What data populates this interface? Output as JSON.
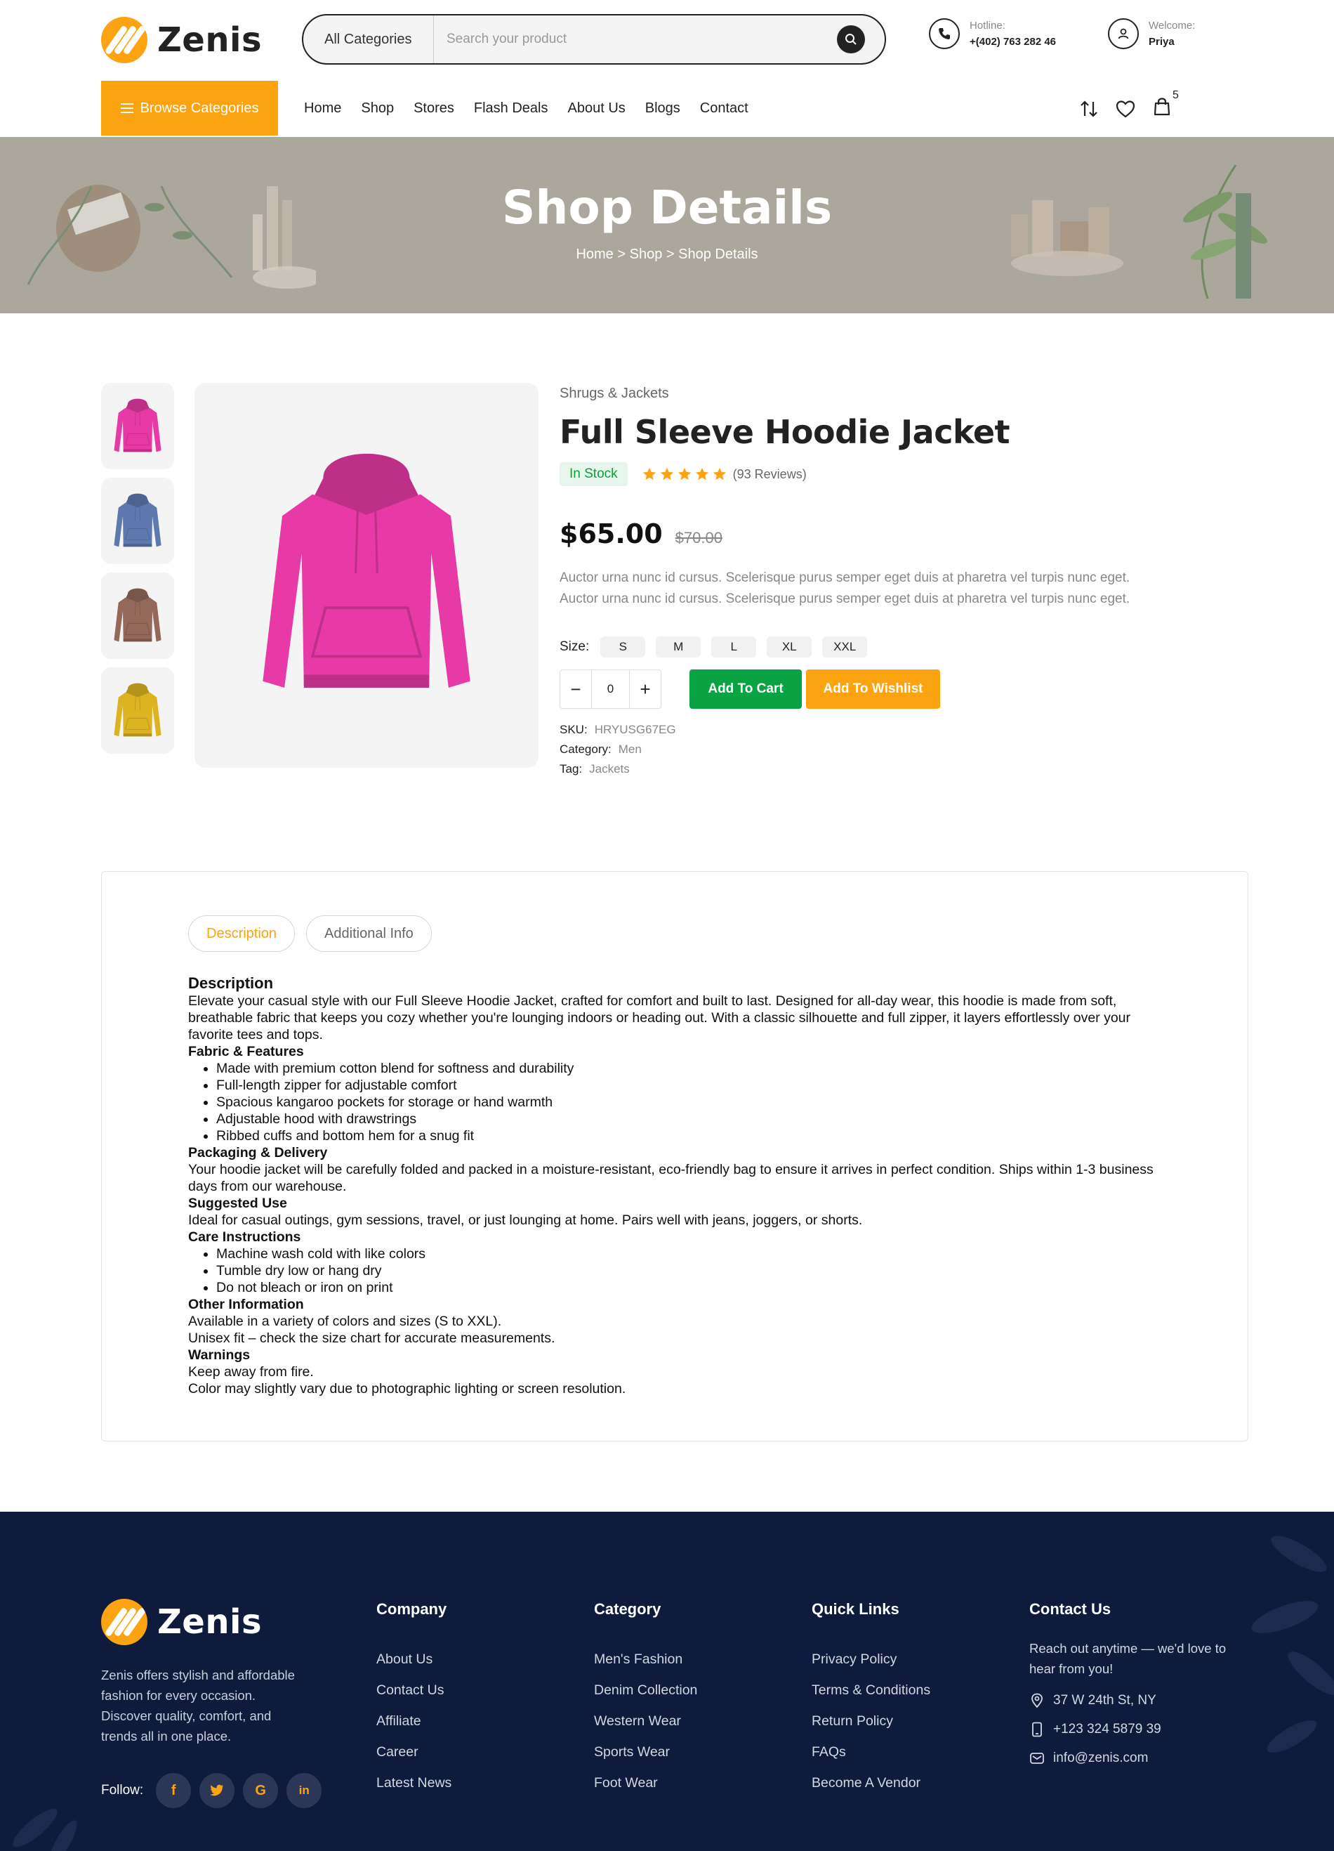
{
  "brand": {
    "name": "Zenis",
    "accent": "#fca311",
    "logo_icon": "slash-stripes-logo"
  },
  "header": {
    "search": {
      "category": "All Categories",
      "placeholder": "Search your product",
      "icon": "search-icon"
    },
    "hotline": {
      "label": "Hotline:",
      "value": "+(402) 763 282 46",
      "icon": "phone-icon"
    },
    "welcome": {
      "label": "Welcome:",
      "value": "Priya",
      "icon": "user-icon"
    }
  },
  "nav": {
    "browse_label": "Browse Categories",
    "links": [
      "Home",
      "Shop",
      "Stores",
      "Flash Deals",
      "About Us",
      "Blogs",
      "Contact"
    ],
    "icons": [
      "compare-icon",
      "heart-icon",
      "bag-icon"
    ],
    "cart_count": "5"
  },
  "banner": {
    "title": "Shop Details",
    "breadcrumb": [
      "Home",
      "Shop",
      "Shop Details"
    ],
    "separator": ">",
    "background": "#aba79d"
  },
  "product": {
    "category": "Shrugs & Jackets",
    "title": "Full Sleeve Hoodie Jacket",
    "stock": "In Stock",
    "rating": 5,
    "reviews": "(93 Reviews)",
    "price": "$65.00",
    "old_price": "$70.00",
    "short_description": "Auctor urna nunc id cursus. Scelerisque purus semper eget duis at pharetra vel turpis nunc eget. Auctor urna nunc id cursus. Scelerisque purus semper eget duis at pharetra vel turpis nunc eget.",
    "size_label": "Size:",
    "sizes": [
      "S",
      "M",
      "L",
      "XL",
      "XXL"
    ],
    "quantity": "0",
    "add_to_cart": "Add To Cart",
    "add_to_wishlist": "Add To Wishlist",
    "thumbnail_colors": [
      "#e83aa6",
      "#5e79b0",
      "#94695a",
      "#dcb421"
    ],
    "main_color": "#e83aa6",
    "meta": [
      {
        "label": "SKU:",
        "value": "HRYUSG67EG"
      },
      {
        "label": "Category:",
        "value": "Men"
      },
      {
        "label": "Tag:",
        "value": "Jackets"
      }
    ]
  },
  "tabs": {
    "items": [
      "Description",
      "Additional Info"
    ],
    "active": "Description",
    "description": {
      "heading": "Description",
      "intro": "Elevate your casual style with our Full Sleeve Hoodie Jacket, crafted for comfort and built to last. Designed for all-day wear, this hoodie is made from soft, breathable fabric that keeps you cozy whether you're lounging indoors or heading out. With a classic silhouette and full zipper, it layers effortlessly over your favorite tees and tops.",
      "fabric_heading": "Fabric & Features",
      "fabric_items": [
        "Made with premium cotton blend for softness and durability",
        "Full-length zipper for adjustable comfort",
        "Spacious kangaroo pockets for storage or hand warmth",
        "Adjustable hood with drawstrings",
        "Ribbed cuffs and bottom hem for a snug fit"
      ],
      "packaging_heading": "Packaging & Delivery",
      "packaging_text": "Your hoodie jacket will be carefully folded and packed in a moisture-resistant, eco-friendly bag to ensure it arrives in perfect condition. Ships within 1-3 business days from our warehouse.",
      "use_heading": "Suggested Use",
      "use_text": "Ideal for casual outings, gym sessions, travel, or just lounging at home. Pairs well with jeans, joggers, or shorts.",
      "care_heading": "Care Instructions",
      "care_items": [
        "Machine wash cold with like colors",
        "Tumble dry low or hang dry",
        "Do not bleach or iron on print"
      ],
      "other_heading": "Other Information",
      "other_lines": [
        "Available in a variety of colors and sizes (S to XXL).",
        "Unisex fit – check the size chart for accurate measurements."
      ],
      "warnings_heading": "Warnings",
      "warnings_lines": [
        "Keep away from fire.",
        "Color may slightly vary due to photographic lighting or screen resolution."
      ]
    }
  },
  "footer": {
    "about": "Zenis offers stylish and affordable fashion for every occasion. Discover quality, comfort, and trends all in one place.",
    "follow_label": "Follow:",
    "social": [
      "facebook-icon",
      "twitter-icon",
      "google-icon",
      "linkedin-icon"
    ],
    "columns": [
      {
        "title": "Company",
        "links": [
          "About Us",
          "Contact Us",
          "Affiliate",
          "Career",
          "Latest News"
        ]
      },
      {
        "title": "Category",
        "links": [
          "Men's Fashion",
          "Denim Collection",
          "Western Wear",
          "Sports Wear",
          "Foot Wear"
        ]
      },
      {
        "title": "Quick Links",
        "links": [
          "Privacy Policy",
          "Terms & Conditions",
          "Return Policy",
          "FAQs",
          "Become A Vendor"
        ]
      }
    ],
    "contact": {
      "title": "Contact Us",
      "intro": "Reach out anytime — we'd love to hear from you!",
      "address": "37 W 24th St, NY",
      "phone": "+123 324 5879 39",
      "email": "info@zenis.com"
    },
    "background": "#0f1b3d"
  }
}
